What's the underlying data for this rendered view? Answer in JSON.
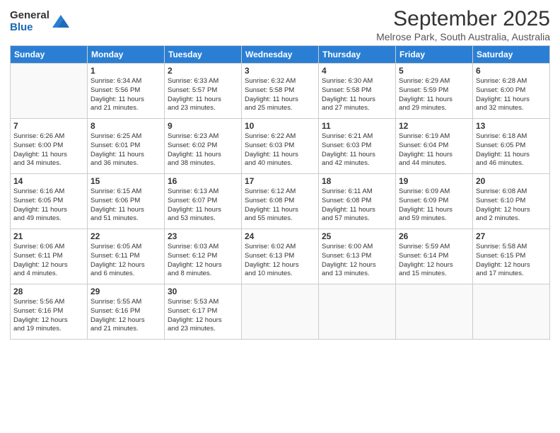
{
  "logo": {
    "general": "General",
    "blue": "Blue"
  },
  "header": {
    "month": "September 2025",
    "location": "Melrose Park, South Australia, Australia"
  },
  "weekdays": [
    "Sunday",
    "Monday",
    "Tuesday",
    "Wednesday",
    "Thursday",
    "Friday",
    "Saturday"
  ],
  "weeks": [
    [
      {
        "day": "",
        "info": ""
      },
      {
        "day": "1",
        "info": "Sunrise: 6:34 AM\nSunset: 5:56 PM\nDaylight: 11 hours\nand 21 minutes."
      },
      {
        "day": "2",
        "info": "Sunrise: 6:33 AM\nSunset: 5:57 PM\nDaylight: 11 hours\nand 23 minutes."
      },
      {
        "day": "3",
        "info": "Sunrise: 6:32 AM\nSunset: 5:58 PM\nDaylight: 11 hours\nand 25 minutes."
      },
      {
        "day": "4",
        "info": "Sunrise: 6:30 AM\nSunset: 5:58 PM\nDaylight: 11 hours\nand 27 minutes."
      },
      {
        "day": "5",
        "info": "Sunrise: 6:29 AM\nSunset: 5:59 PM\nDaylight: 11 hours\nand 29 minutes."
      },
      {
        "day": "6",
        "info": "Sunrise: 6:28 AM\nSunset: 6:00 PM\nDaylight: 11 hours\nand 32 minutes."
      }
    ],
    [
      {
        "day": "7",
        "info": "Sunrise: 6:26 AM\nSunset: 6:00 PM\nDaylight: 11 hours\nand 34 minutes."
      },
      {
        "day": "8",
        "info": "Sunrise: 6:25 AM\nSunset: 6:01 PM\nDaylight: 11 hours\nand 36 minutes."
      },
      {
        "day": "9",
        "info": "Sunrise: 6:23 AM\nSunset: 6:02 PM\nDaylight: 11 hours\nand 38 minutes."
      },
      {
        "day": "10",
        "info": "Sunrise: 6:22 AM\nSunset: 6:03 PM\nDaylight: 11 hours\nand 40 minutes."
      },
      {
        "day": "11",
        "info": "Sunrise: 6:21 AM\nSunset: 6:03 PM\nDaylight: 11 hours\nand 42 minutes."
      },
      {
        "day": "12",
        "info": "Sunrise: 6:19 AM\nSunset: 6:04 PM\nDaylight: 11 hours\nand 44 minutes."
      },
      {
        "day": "13",
        "info": "Sunrise: 6:18 AM\nSunset: 6:05 PM\nDaylight: 11 hours\nand 46 minutes."
      }
    ],
    [
      {
        "day": "14",
        "info": "Sunrise: 6:16 AM\nSunset: 6:05 PM\nDaylight: 11 hours\nand 49 minutes."
      },
      {
        "day": "15",
        "info": "Sunrise: 6:15 AM\nSunset: 6:06 PM\nDaylight: 11 hours\nand 51 minutes."
      },
      {
        "day": "16",
        "info": "Sunrise: 6:13 AM\nSunset: 6:07 PM\nDaylight: 11 hours\nand 53 minutes."
      },
      {
        "day": "17",
        "info": "Sunrise: 6:12 AM\nSunset: 6:08 PM\nDaylight: 11 hours\nand 55 minutes."
      },
      {
        "day": "18",
        "info": "Sunrise: 6:11 AM\nSunset: 6:08 PM\nDaylight: 11 hours\nand 57 minutes."
      },
      {
        "day": "19",
        "info": "Sunrise: 6:09 AM\nSunset: 6:09 PM\nDaylight: 11 hours\nand 59 minutes."
      },
      {
        "day": "20",
        "info": "Sunrise: 6:08 AM\nSunset: 6:10 PM\nDaylight: 12 hours\nand 2 minutes."
      }
    ],
    [
      {
        "day": "21",
        "info": "Sunrise: 6:06 AM\nSunset: 6:11 PM\nDaylight: 12 hours\nand 4 minutes."
      },
      {
        "day": "22",
        "info": "Sunrise: 6:05 AM\nSunset: 6:11 PM\nDaylight: 12 hours\nand 6 minutes."
      },
      {
        "day": "23",
        "info": "Sunrise: 6:03 AM\nSunset: 6:12 PM\nDaylight: 12 hours\nand 8 minutes."
      },
      {
        "day": "24",
        "info": "Sunrise: 6:02 AM\nSunset: 6:13 PM\nDaylight: 12 hours\nand 10 minutes."
      },
      {
        "day": "25",
        "info": "Sunrise: 6:00 AM\nSunset: 6:13 PM\nDaylight: 12 hours\nand 13 minutes."
      },
      {
        "day": "26",
        "info": "Sunrise: 5:59 AM\nSunset: 6:14 PM\nDaylight: 12 hours\nand 15 minutes."
      },
      {
        "day": "27",
        "info": "Sunrise: 5:58 AM\nSunset: 6:15 PM\nDaylight: 12 hours\nand 17 minutes."
      }
    ],
    [
      {
        "day": "28",
        "info": "Sunrise: 5:56 AM\nSunset: 6:16 PM\nDaylight: 12 hours\nand 19 minutes."
      },
      {
        "day": "29",
        "info": "Sunrise: 5:55 AM\nSunset: 6:16 PM\nDaylight: 12 hours\nand 21 minutes."
      },
      {
        "day": "30",
        "info": "Sunrise: 5:53 AM\nSunset: 6:17 PM\nDaylight: 12 hours\nand 23 minutes."
      },
      {
        "day": "",
        "info": ""
      },
      {
        "day": "",
        "info": ""
      },
      {
        "day": "",
        "info": ""
      },
      {
        "day": "",
        "info": ""
      }
    ]
  ]
}
